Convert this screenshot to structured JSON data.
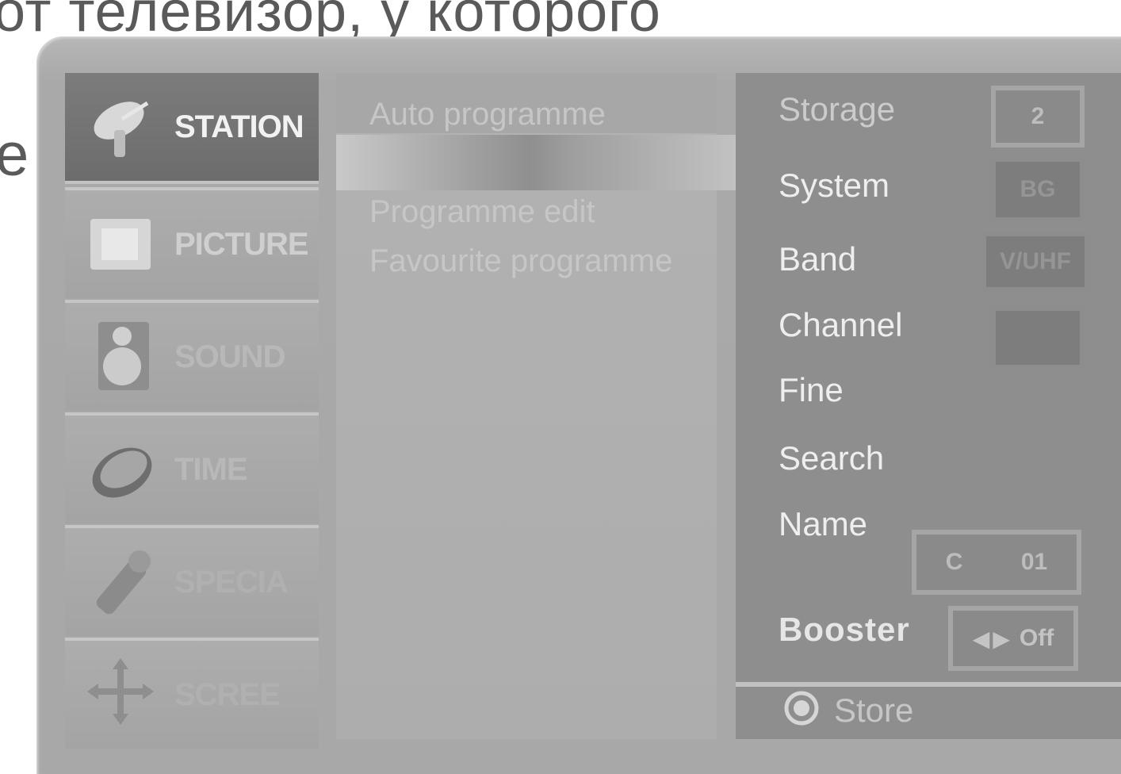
{
  "document": {
    "top_text": "от телевизор, у которого",
    "left_fragment": "е"
  },
  "menu": {
    "items": [
      {
        "label": "STATION",
        "icon": "satellite-dish-icon"
      },
      {
        "label": "PICTURE",
        "icon": "picture-icon"
      },
      {
        "label": "SOUND",
        "icon": "speaker-icon"
      },
      {
        "label": "TIME",
        "icon": "clock-icon"
      },
      {
        "label": "SPECIA",
        "icon": "special-tool-icon"
      },
      {
        "label": "SCREE",
        "icon": "screen-arrows-icon"
      }
    ]
  },
  "submenu": {
    "items": [
      "Auto programme",
      "Programme edit",
      "Favourite programme"
    ]
  },
  "settings": {
    "storage": {
      "label": "Storage",
      "value": "2"
    },
    "system": {
      "label": "System",
      "value": "BG"
    },
    "band": {
      "label": "Band",
      "value": "V/UHF"
    },
    "channel": {
      "label": "Channel",
      "value": ""
    },
    "fine": {
      "label": "Fine"
    },
    "search": {
      "label": "Search"
    },
    "name": {
      "label": "Name",
      "prefix": "C",
      "value": "01"
    },
    "booster": {
      "label": "Booster",
      "value": "Off"
    },
    "store": {
      "label": "Store"
    }
  },
  "colors": {
    "active_item": "#6f6f6f",
    "panel": "#8e8e8e",
    "frame": "#a9a9a9"
  }
}
